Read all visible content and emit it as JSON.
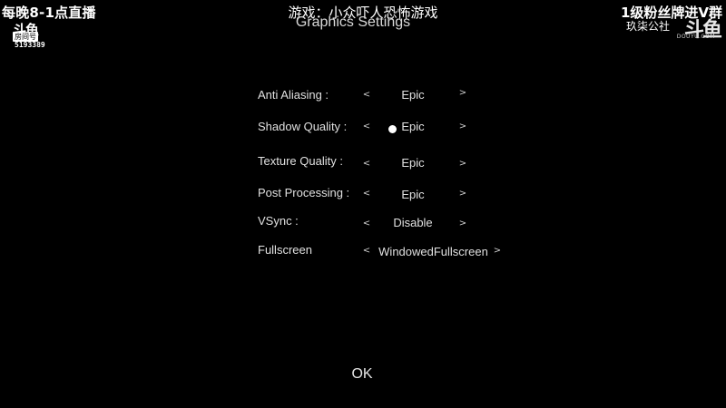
{
  "stream_overlay": {
    "schedule": "每晚8-1点直播",
    "logo": "斗鱼",
    "room_tag": "房间号",
    "room_number": "5193389",
    "game_caption": "游戏：小众吓人恐怖游戏",
    "fan_group": "1级粉丝牌进V群",
    "channel": "玖柒公社",
    "right_logo": "斗鱼",
    "right_logo_domain": "DOUYU.COM"
  },
  "game_title": "Graphics Settings",
  "settings": [
    {
      "label": "Anti Aliasing :",
      "value": "Epic",
      "left_arrow": "<",
      "right_arrow": ">"
    },
    {
      "label": "Shadow Quality :",
      "value": "Epic",
      "left_arrow": "<",
      "right_arrow": ">"
    },
    {
      "label": "Texture Quality :",
      "value": "Epic",
      "left_arrow": "<",
      "right_arrow": ">"
    },
    {
      "label": "Post Processing :",
      "value": "Epic",
      "left_arrow": "<",
      "right_arrow": ">"
    },
    {
      "label": "VSync :",
      "value": "Disable",
      "left_arrow": "<",
      "right_arrow": ">"
    },
    {
      "label": "Fullscreen",
      "value": "WindowedFullscreen",
      "left_arrow": "<",
      "right_arrow": ">"
    }
  ],
  "ok_label": "OK",
  "colors": {
    "background": "#000000",
    "text": "#e0e0e0"
  }
}
